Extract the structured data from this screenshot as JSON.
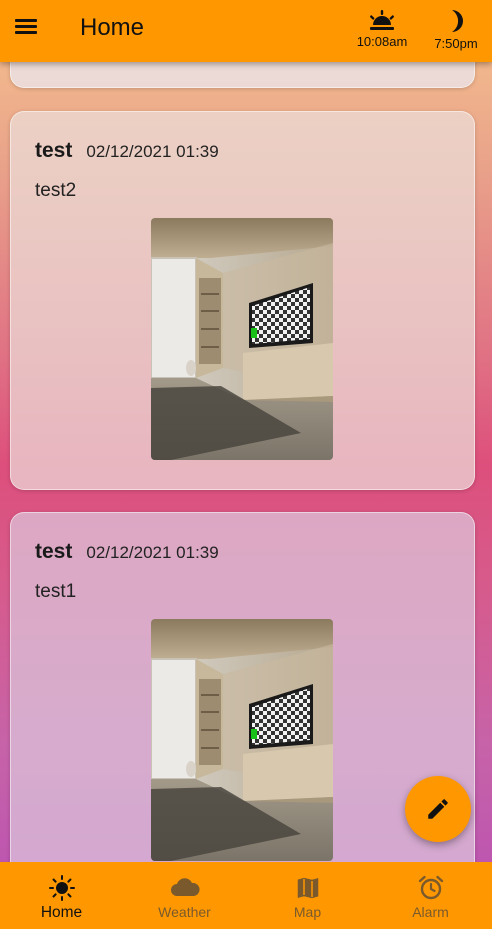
{
  "appbar": {
    "title": "Home",
    "sunrise_time": "10:08am",
    "sunset_time": "7:50pm"
  },
  "posts": [
    {
      "author": "test",
      "date": "02/12/2021 01:39",
      "text": "test2",
      "image": "room-with-tv-photo"
    },
    {
      "author": "test",
      "date": "02/12/2021 01:39",
      "text": "test1",
      "image": "room-with-tv-photo"
    }
  ],
  "fab": {
    "icon": "pencil-icon"
  },
  "nav": {
    "items": [
      {
        "label": "Home",
        "icon": "sun-icon",
        "active": true
      },
      {
        "label": "Weather",
        "icon": "cloud-icon",
        "active": false
      },
      {
        "label": "Map",
        "icon": "map-icon",
        "active": false
      },
      {
        "label": "Alarm",
        "icon": "alarm-clock-icon",
        "active": false
      }
    ]
  },
  "colors": {
    "primary": "#ff9800"
  }
}
